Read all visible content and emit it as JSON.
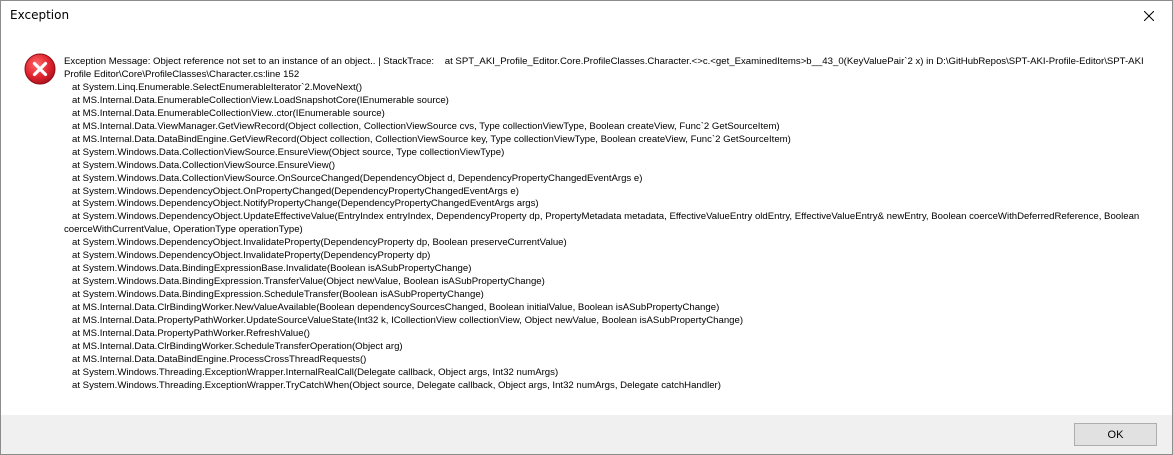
{
  "window": {
    "title": "Exception"
  },
  "dialog": {
    "icon": "error-icon",
    "message": "Exception Message: Object reference not set to an instance of an object.. | StackTrace:    at SPT_AKI_Profile_Editor.Core.ProfileClasses.Character.<>c.<get_ExaminedItems>b__43_0(KeyValuePair`2 x) in D:\\GitHubRepos\\SPT-AKI-Profile-Editor\\SPT-AKI Profile Editor\\Core\\ProfileClasses\\Character.cs:line 152\n   at System.Linq.Enumerable.SelectEnumerableIterator`2.MoveNext()\n   at MS.Internal.Data.EnumerableCollectionView.LoadSnapshotCore(IEnumerable source)\n   at MS.Internal.Data.EnumerableCollectionView..ctor(IEnumerable source)\n   at MS.Internal.Data.ViewManager.GetViewRecord(Object collection, CollectionViewSource cvs, Type collectionViewType, Boolean createView, Func`2 GetSourceItem)\n   at MS.Internal.Data.DataBindEngine.GetViewRecord(Object collection, CollectionViewSource key, Type collectionViewType, Boolean createView, Func`2 GetSourceItem)\n   at System.Windows.Data.CollectionViewSource.EnsureView(Object source, Type collectionViewType)\n   at System.Windows.Data.CollectionViewSource.EnsureView()\n   at System.Windows.Data.CollectionViewSource.OnSourceChanged(DependencyObject d, DependencyPropertyChangedEventArgs e)\n   at System.Windows.DependencyObject.OnPropertyChanged(DependencyPropertyChangedEventArgs e)\n   at System.Windows.DependencyObject.NotifyPropertyChange(DependencyPropertyChangedEventArgs args)\n   at System.Windows.DependencyObject.UpdateEffectiveValue(EntryIndex entryIndex, DependencyProperty dp, PropertyMetadata metadata, EffectiveValueEntry oldEntry, EffectiveValueEntry& newEntry, Boolean coerceWithDeferredReference, Boolean coerceWithCurrentValue, OperationType operationType)\n   at System.Windows.DependencyObject.InvalidateProperty(DependencyProperty dp, Boolean preserveCurrentValue)\n   at System.Windows.DependencyObject.InvalidateProperty(DependencyProperty dp)\n   at System.Windows.Data.BindingExpressionBase.Invalidate(Boolean isASubPropertyChange)\n   at System.Windows.Data.BindingExpression.TransferValue(Object newValue, Boolean isASubPropertyChange)\n   at System.Windows.Data.BindingExpression.ScheduleTransfer(Boolean isASubPropertyChange)\n   at MS.Internal.Data.ClrBindingWorker.NewValueAvailable(Boolean dependencySourcesChanged, Boolean initialValue, Boolean isASubPropertyChange)\n   at MS.Internal.Data.PropertyPathWorker.UpdateSourceValueState(Int32 k, ICollectionView collectionView, Object newValue, Boolean isASubPropertyChange)\n   at MS.Internal.Data.PropertyPathWorker.RefreshValue()\n   at MS.Internal.Data.ClrBindingWorker.ScheduleTransferOperation(Object arg)\n   at MS.Internal.Data.DataBindEngine.ProcessCrossThreadRequests()\n   at System.Windows.Threading.ExceptionWrapper.InternalRealCall(Delegate callback, Object args, Int32 numArgs)\n   at System.Windows.Threading.ExceptionWrapper.TryCatchWhen(Object source, Delegate callback, Object args, Int32 numArgs, Delegate catchHandler)"
  },
  "buttons": {
    "ok_label": "OK"
  },
  "colors": {
    "error_red": "#e81123",
    "footer_bg": "#f0f0f0",
    "button_bg": "#e1e1e1",
    "button_border": "#adadad"
  }
}
